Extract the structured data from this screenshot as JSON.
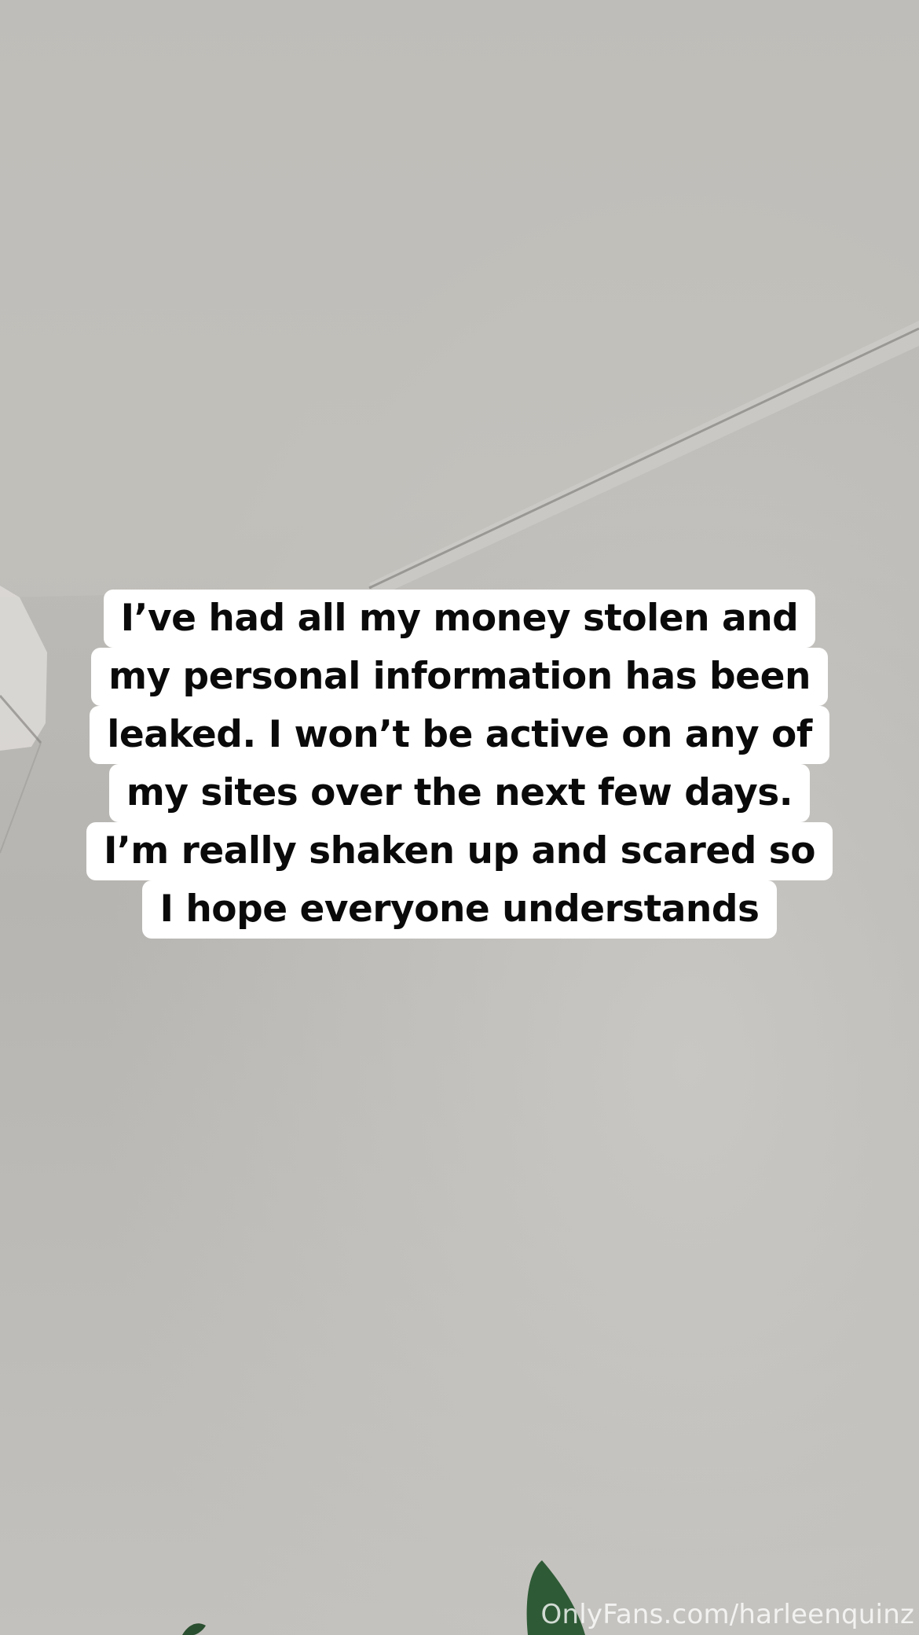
{
  "caption": {
    "lines": [
      "I’ve had all my money stolen and",
      "my personal information has been",
      "leaked. I won’t be active on any of",
      "my sites over the next few days.",
      "I’m really shaken up and scared so",
      "I hope everyone understands"
    ],
    "background_color": "#ffffff",
    "text_color": "#0a0a0a"
  },
  "watermark": {
    "text": "OnlyFans.com/harleenquinz"
  },
  "scene": {
    "wall_color": "#bab8b4",
    "plant_color": "#2f5a36"
  }
}
